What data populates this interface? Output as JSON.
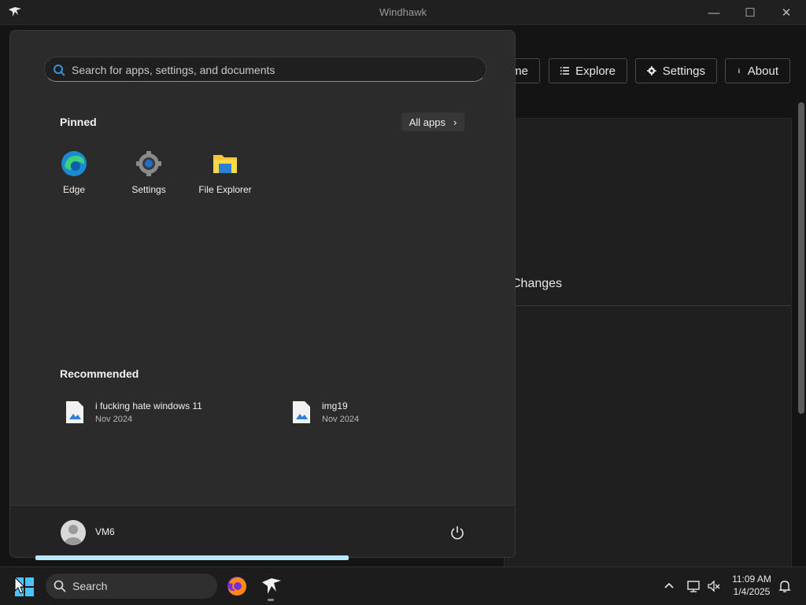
{
  "window": {
    "title": "Windhawk",
    "nav": [
      {
        "label": "me",
        "icon": "home-icon"
      },
      {
        "label": "Explore",
        "icon": "list-icon"
      },
      {
        "label": "Settings",
        "icon": "gear-icon"
      },
      {
        "label": "About",
        "icon": "info-icon"
      }
    ],
    "content_heading": "Changes"
  },
  "start_menu": {
    "search_placeholder": "Search for apps, settings, and documents",
    "pinned_title": "Pinned",
    "all_apps_label": "All apps",
    "pinned": [
      {
        "label": "Edge",
        "icon": "edge-icon"
      },
      {
        "label": "Settings",
        "icon": "settings-gear-icon"
      },
      {
        "label": "File Explorer",
        "icon": "folder-icon"
      }
    ],
    "recommended_title": "Recommended",
    "recommended": [
      {
        "name": "i fucking hate windows 11",
        "date": "Nov 2024",
        "icon": "image-file-icon"
      },
      {
        "name": "img19",
        "date": "Nov 2024",
        "icon": "image-file-icon"
      }
    ],
    "user_name": "VM6"
  },
  "taskbar": {
    "search_label": "Search",
    "clock_time": "11:09 AM",
    "clock_date": "1/4/2025"
  },
  "colors": {
    "accent": "#3b8fd6",
    "folder": "#f5c533",
    "progress": "#b8e8ff"
  }
}
